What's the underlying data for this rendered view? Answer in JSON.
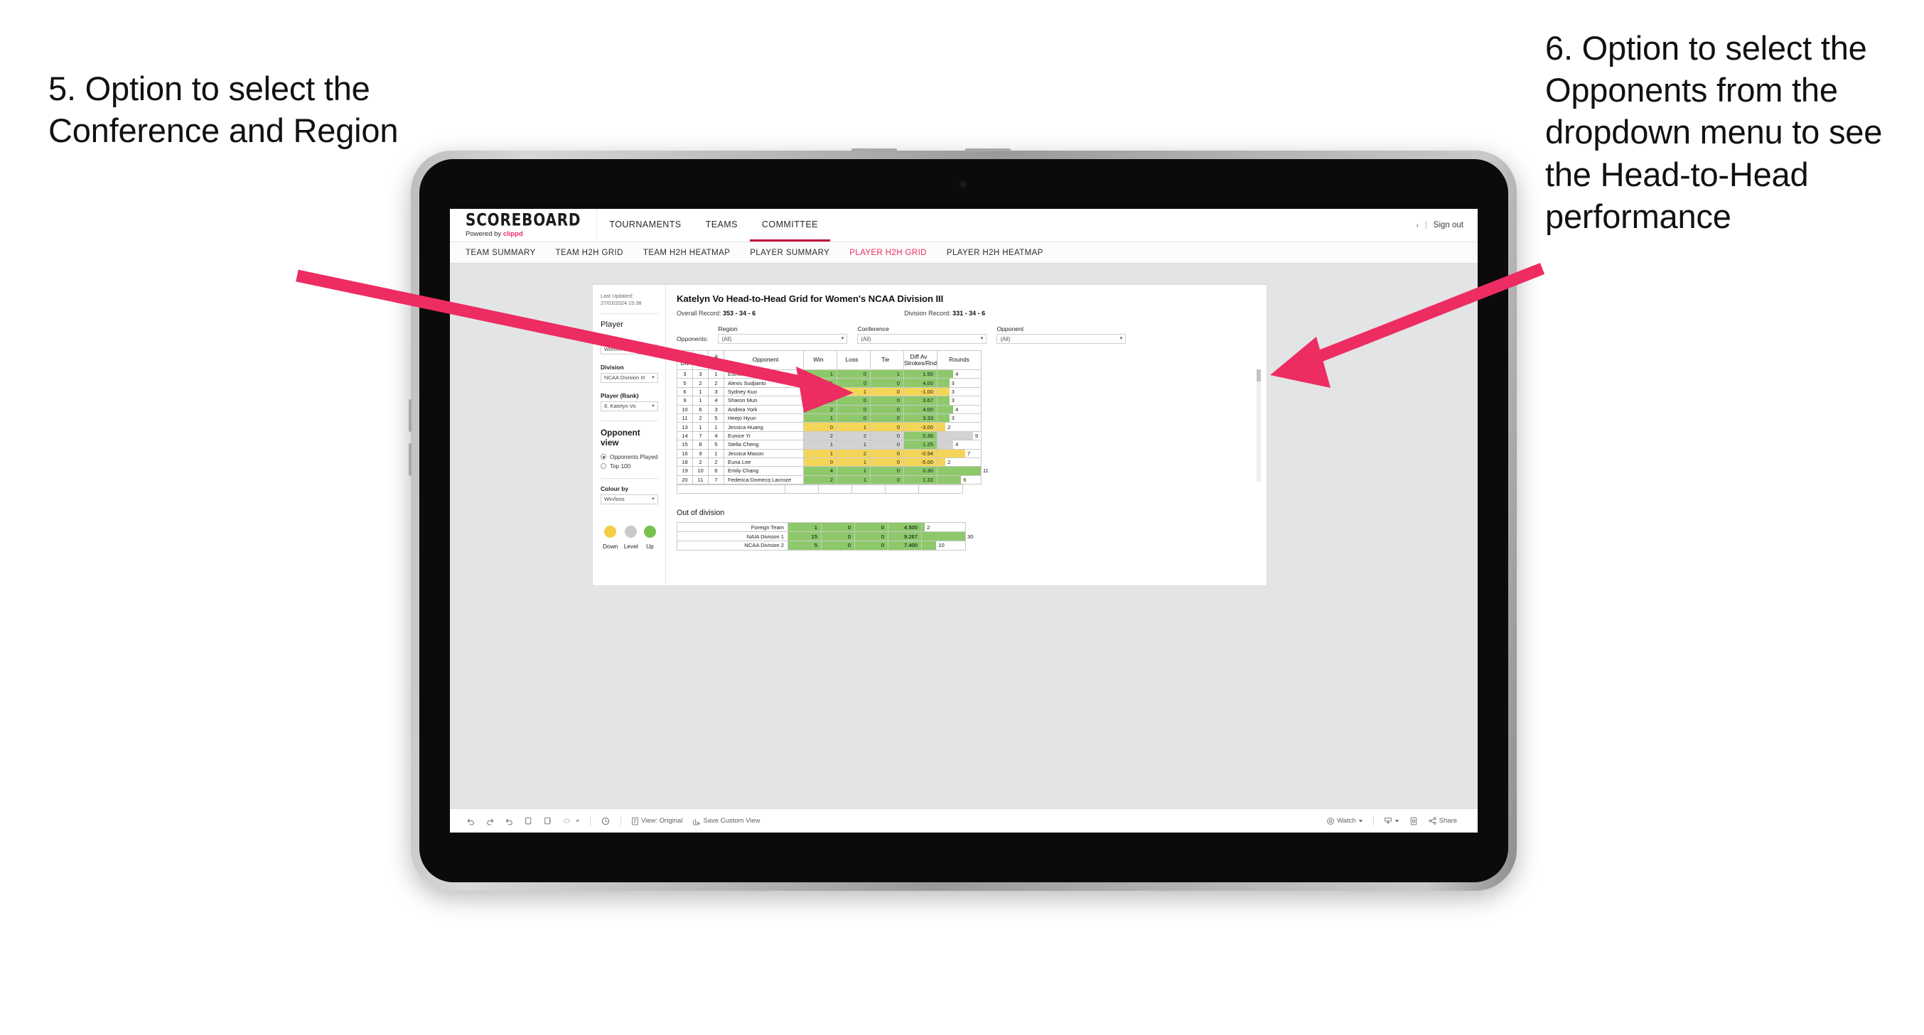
{
  "annotations": {
    "left": "5. Option to select the Conference and Region",
    "right": "6. Option to select the Opponents from the dropdown menu to see the Head-to-Head performance"
  },
  "colors": {
    "accent_pink": "#ED2C62",
    "arrow_pink": "#ED2C62",
    "up_green": "#8DC96A",
    "down_yellow": "#F5D558",
    "level_grey": "#D3D3D3",
    "page_background": "#E3E4E6"
  },
  "app": {
    "brand": {
      "name": "SCOREBOARD",
      "powered_prefix": "Powered by",
      "powered_brand": "clippd"
    },
    "top_nav": [
      {
        "label": "TOURNAMENTS",
        "active": false
      },
      {
        "label": "TEAMS",
        "active": false
      },
      {
        "label": "COMMITTEE",
        "active": true
      }
    ],
    "top_right": {
      "chevron": "chevron-right-icon",
      "separator": "|",
      "sign_out": "Sign out"
    },
    "sub_nav": [
      {
        "label": "TEAM SUMMARY",
        "active": false
      },
      {
        "label": "TEAM H2H GRID",
        "active": false
      },
      {
        "label": "TEAM H2H HEATMAP",
        "active": false
      },
      {
        "label": "PLAYER SUMMARY",
        "active": false
      },
      {
        "label": "PLAYER H2H GRID",
        "active": true
      },
      {
        "label": "PLAYER H2H HEATMAP",
        "active": false
      }
    ]
  },
  "sidebar": {
    "last_updated": "Last Updated: 27/03/2024 15:38",
    "player_heading": "Player",
    "fields": [
      {
        "label": "Gender",
        "value": "Women's"
      },
      {
        "label": "Division",
        "value": "NCAA Division III"
      },
      {
        "label": "Player (Rank)",
        "value": "8. Katelyn Vo"
      }
    ],
    "opponent_view": {
      "heading": "Opponent view",
      "options": [
        {
          "label": "Opponents Played",
          "selected": true
        },
        {
          "label": "Top 100",
          "selected": false
        }
      ]
    },
    "colour_by": {
      "label": "Colour by",
      "value": "Win/loss"
    },
    "legend": [
      {
        "label": "Down",
        "color": "#F5D558"
      },
      {
        "label": "Level",
        "color": "#C9C9C9"
      },
      {
        "label": "Up",
        "color": "#77C14A"
      }
    ]
  },
  "main": {
    "title": "Katelyn Vo Head-to-Head Grid for Women's NCAA Division III",
    "overall_record_label": "Overall Record:",
    "overall_record_value": "353 - 34 - 6",
    "division_record_label": "Division Record:",
    "division_record_value": "331 - 34 - 6",
    "opponents_label": "Opponents:",
    "filters": [
      {
        "label": "Region",
        "value": "(All)"
      },
      {
        "label": "Conference",
        "value": "(All)"
      },
      {
        "label": "Opponent",
        "value": "(All)"
      }
    ]
  },
  "grid": {
    "headers": [
      "# Div",
      "# Reg",
      "# Conf",
      "Opponent",
      "Win",
      "Loss",
      "Tie",
      "Diff Av Strokes/Rnd",
      "Rounds"
    ],
    "header_lines": [
      [
        "#",
        "Div"
      ],
      [
        "#",
        "Reg"
      ],
      [
        "#",
        "Conf"
      ],
      [
        "Opponent"
      ],
      [
        "Win"
      ],
      [
        "Loss"
      ],
      [
        "Tie"
      ],
      [
        "Diff Av",
        "Strokes/Rnd"
      ],
      [
        "Rounds"
      ]
    ],
    "rows": [
      {
        "div": "3",
        "reg": "3",
        "conf": "1",
        "opponent": "Esther Lee",
        "win": "1",
        "loss": "0",
        "tie": "1",
        "diff": "1.50",
        "rounds": "4",
        "state": "up"
      },
      {
        "div": "5",
        "reg": "2",
        "conf": "2",
        "opponent": "Alexis Sudjianto",
        "win": "1",
        "loss": "0",
        "tie": "0",
        "diff": "4.00",
        "rounds": "3",
        "state": "up"
      },
      {
        "div": "6",
        "reg": "1",
        "conf": "3",
        "opponent": "Sydney Kuo",
        "win": "0",
        "loss": "1",
        "tie": "0",
        "diff": "-1.00",
        "rounds": "3",
        "state": "down"
      },
      {
        "div": "9",
        "reg": "1",
        "conf": "4",
        "opponent": "Sharon Mun",
        "win": "1",
        "loss": "0",
        "tie": "0",
        "diff": "3.67",
        "rounds": "3",
        "state": "up"
      },
      {
        "div": "10",
        "reg": "6",
        "conf": "3",
        "opponent": "Andrea York",
        "win": "2",
        "loss": "0",
        "tie": "0",
        "diff": "4.00",
        "rounds": "4",
        "state": "up"
      },
      {
        "div": "11",
        "reg": "2",
        "conf": "5",
        "opponent": "Heejo Hyun",
        "win": "1",
        "loss": "0",
        "tie": "0",
        "diff": "3.33",
        "rounds": "3",
        "state": "up"
      },
      {
        "div": "13",
        "reg": "1",
        "conf": "1",
        "opponent": "Jessica Huang",
        "win": "0",
        "loss": "1",
        "tie": "0",
        "diff": "-3.00",
        "rounds": "2",
        "state": "down"
      },
      {
        "div": "14",
        "reg": "7",
        "conf": "4",
        "opponent": "Eunice Yi",
        "win": "2",
        "loss": "2",
        "tie": "0",
        "diff": "0.38",
        "rounds": "9",
        "state": "level",
        "diff_state": "up"
      },
      {
        "div": "15",
        "reg": "8",
        "conf": "5",
        "opponent": "Stella Cheng",
        "win": "1",
        "loss": "1",
        "tie": "0",
        "diff": "1.25",
        "rounds": "4",
        "state": "level",
        "diff_state": "up"
      },
      {
        "div": "16",
        "reg": "9",
        "conf": "1",
        "opponent": "Jessica Mason",
        "win": "1",
        "loss": "2",
        "tie": "0",
        "diff": "-0.94",
        "rounds": "7",
        "state": "down"
      },
      {
        "div": "18",
        "reg": "2",
        "conf": "2",
        "opponent": "Euna Lee",
        "win": "0",
        "loss": "1",
        "tie": "0",
        "diff": "-5.00",
        "rounds": "2",
        "state": "down"
      },
      {
        "div": "19",
        "reg": "10",
        "conf": "6",
        "opponent": "Emily Chang",
        "win": "4",
        "loss": "1",
        "tie": "0",
        "diff": "0.30",
        "rounds": "11",
        "state": "up"
      },
      {
        "div": "20",
        "reg": "11",
        "conf": "7",
        "opponent": "Federica Domecq Lacroze",
        "win": "2",
        "loss": "1",
        "tie": "0",
        "diff": "1.33",
        "rounds": "6",
        "state": "up"
      }
    ],
    "max_rounds": 11
  },
  "out_of_division": {
    "title": "Out of division",
    "rows": [
      {
        "name": "Foreign Team",
        "win": "1",
        "loss": "0",
        "tie": "0",
        "diff": "4.500",
        "rounds": "2",
        "state": "up"
      },
      {
        "name": "NAIA Division 1",
        "win": "15",
        "loss": "0",
        "tie": "0",
        "diff": "9.267",
        "rounds": "30",
        "state": "up"
      },
      {
        "name": "NCAA Division 2",
        "win": "5",
        "loss": "0",
        "tie": "0",
        "diff": "7.400",
        "rounds": "10",
        "state": "up"
      }
    ],
    "max_rounds": 30
  },
  "toolbar": {
    "undo": "undo-icon",
    "redo": "redo-icon",
    "revert": "revert-icon",
    "refresh": "refresh-data-icon",
    "pause": "pause-auto-update-icon",
    "highlight": "highlight-icon",
    "alert": "alert-icon",
    "view_label": "View: Original",
    "save_custom_view": "Save Custom View",
    "watch": "Watch",
    "download": "download-icon",
    "fullscreen": "fullscreen-icon",
    "share": "Share"
  }
}
